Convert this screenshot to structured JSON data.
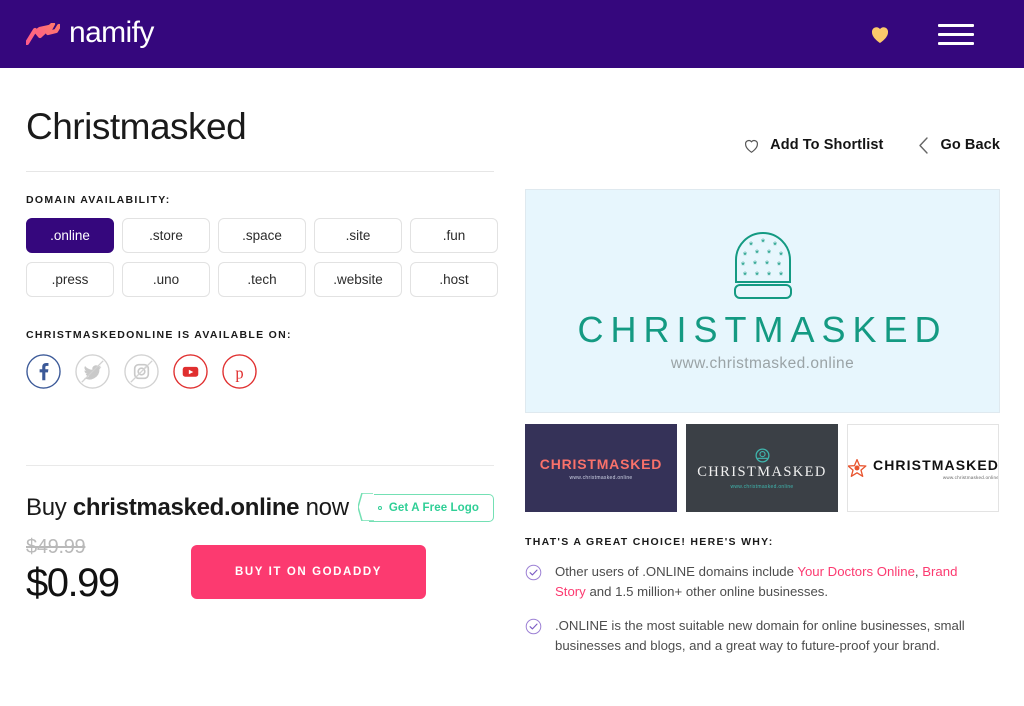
{
  "header": {
    "brand_name": "namify",
    "brand_mark_icon": "zigzag-chart-icon",
    "shortlist_heart_icon": "heart-filled-icon",
    "menu_icon": "hamburger-menu-icon"
  },
  "main": {
    "page_title": "Christmasked",
    "actions": {
      "add_to_shortlist": "Add To Shortlist",
      "add_to_shortlist_icon": "heart-outline-icon",
      "go_back": "Go Back",
      "go_back_icon": "chevron-left-icon"
    },
    "domain_availability": {
      "label": "DOMAIN AVAILABILITY:",
      "selected": ".online",
      "extensions": [
        ".online",
        ".store",
        ".space",
        ".site",
        ".fun",
        ".press",
        ".uno",
        ".tech",
        ".website",
        ".host"
      ]
    },
    "social": {
      "label": "CHRISTMASKEDONLINE IS AVAILABLE ON:",
      "networks": [
        {
          "name": "facebook",
          "icon": "facebook-icon",
          "available": true,
          "color": "#3b5998"
        },
        {
          "name": "twitter",
          "icon": "twitter-icon",
          "available": false,
          "color": "#c9c9c9"
        },
        {
          "name": "instagram",
          "icon": "instagram-icon",
          "available": false,
          "color": "#c9c9c9"
        },
        {
          "name": "youtube",
          "icon": "youtube-icon",
          "available": true,
          "color": "#e02f2f"
        },
        {
          "name": "pinterest",
          "icon": "pinterest-icon",
          "available": true,
          "color": "#e02f2f"
        }
      ]
    },
    "purchase": {
      "buy_prefix": "Buy",
      "domain": "christmasked.online",
      "buy_suffix": "now",
      "free_logo_badge": "Get A Free Logo",
      "free_logo_icon": "price-tag-icon",
      "price_old": "$49.99",
      "price_new": "$0.99",
      "buy_button": "BUY IT ON GODADDY"
    }
  },
  "preview": {
    "main_logo": {
      "icon": "snow-globe-icon",
      "wordmark": "CHRISTMASKED",
      "url": "www.christmasked.online",
      "background": "#e7f6fd",
      "accent": "#149a82"
    },
    "thumbnails": [
      {
        "wordmark": "CHRISTMASKED",
        "url": "www.christmasked.online",
        "background": "#353258",
        "text_color": "#f9716a",
        "icon": "none"
      },
      {
        "wordmark": "CHRISTMASKED",
        "url": "www.christmasked.online",
        "background": "#3b4046",
        "text_color": "#f0f0f0",
        "icon": "circular-emblem-icon"
      },
      {
        "wordmark": "CHRISTMASKED",
        "url": "www.christmasked.online",
        "background": "#ffffff",
        "text_color": "#111111",
        "icon": "star-icon"
      }
    ]
  },
  "why": {
    "label": "THAT'S A GREAT CHOICE! HERE'S WHY:",
    "items": [
      {
        "icon": "check-circle-icon",
        "before": "Other users of .ONLINE domains include ",
        "link1": "Your Doctors Online",
        "mid": ", ",
        "link2": "Brand Story",
        "after": " and 1.5 million+ other online businesses."
      },
      {
        "icon": "check-circle-icon",
        "before": ".ONLINE is the most suitable new domain for online businesses, small businesses and blogs, and a great way to future-proof your brand.",
        "link1": "",
        "mid": "",
        "link2": "",
        "after": ""
      }
    ]
  },
  "colors": {
    "header_purple": "#35077d",
    "accent_pink": "#fc3a70",
    "badge_green": "#2fcf96",
    "logo_teal": "#149a82"
  }
}
